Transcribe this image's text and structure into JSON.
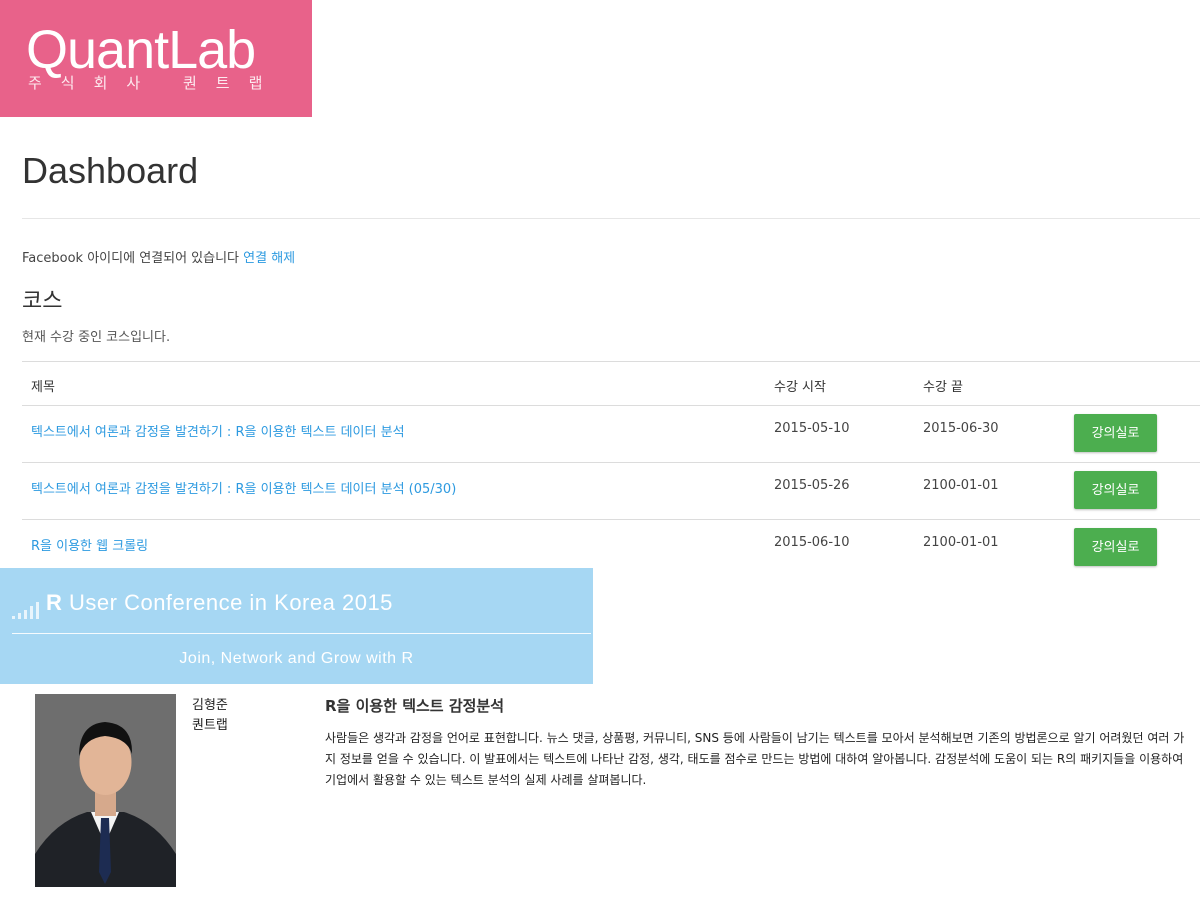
{
  "logo": {
    "main": "QuantLab",
    "sub": "주식회사 퀀트랩"
  },
  "page": {
    "title": "Dashboard"
  },
  "facebook": {
    "text": "Facebook 아이디에 연결되어 있습니다 ",
    "link": "연결 해제"
  },
  "courses": {
    "title": "코스",
    "description": "현재 수강 중인 코스입니다.",
    "columns": {
      "title": "제목",
      "start": "수강 시작",
      "end": "수강 끝"
    },
    "rows": [
      {
        "title": "텍스트에서 여론과 감정을 발견하기 : R을 이용한 텍스트 데이터 분석",
        "start": "2015-05-10",
        "end": "2015-06-30",
        "button": "강의실로"
      },
      {
        "title": "텍스트에서 여론과 감정을 발견하기 : R을 이용한 텍스트 데이터 분석 (05/30)",
        "start": "2015-05-26",
        "end": "2100-01-01",
        "button": "강의실로"
      },
      {
        "title": "R을 이용한 웹 크롤링",
        "start": "2015-06-10",
        "end": "2100-01-01",
        "button": "강의실로"
      }
    ]
  },
  "banner": {
    "title_bold": "R",
    "title_rest": " User Conference in Korea 2015",
    "subtitle": "Join, Network and Grow with R"
  },
  "speaker": {
    "name": "김형준",
    "org": "퀀트랩",
    "talk_title": "R을 이용한 텍스트 감정분석",
    "talk_description": "사람들은 생각과 감정을 언어로 표현합니다. 뉴스 댓글, 상품평, 커뮤니티, SNS 등에 사람들이 남기는 텍스트를 모아서 분석해보면 기존의 방법론으로 알기 어려웠던 여러 가지 정보를 얻을 수 있습니다. 이 발표에서는 텍스트에 나타난 감정, 생각, 태도를 점수로 만드는 방법에 대하여 알아봅니다. 감정분석에 도움이 되는 R의 패키지들을 이용하여 기업에서 활용할 수 있는 텍스트 분석의 실제 사례를 살펴봅니다."
  },
  "colors": {
    "logo_bg": "#e8628a",
    "link": "#2d9ae0",
    "button": "#4cae4f",
    "banner_bg": "#a6d7f3"
  }
}
